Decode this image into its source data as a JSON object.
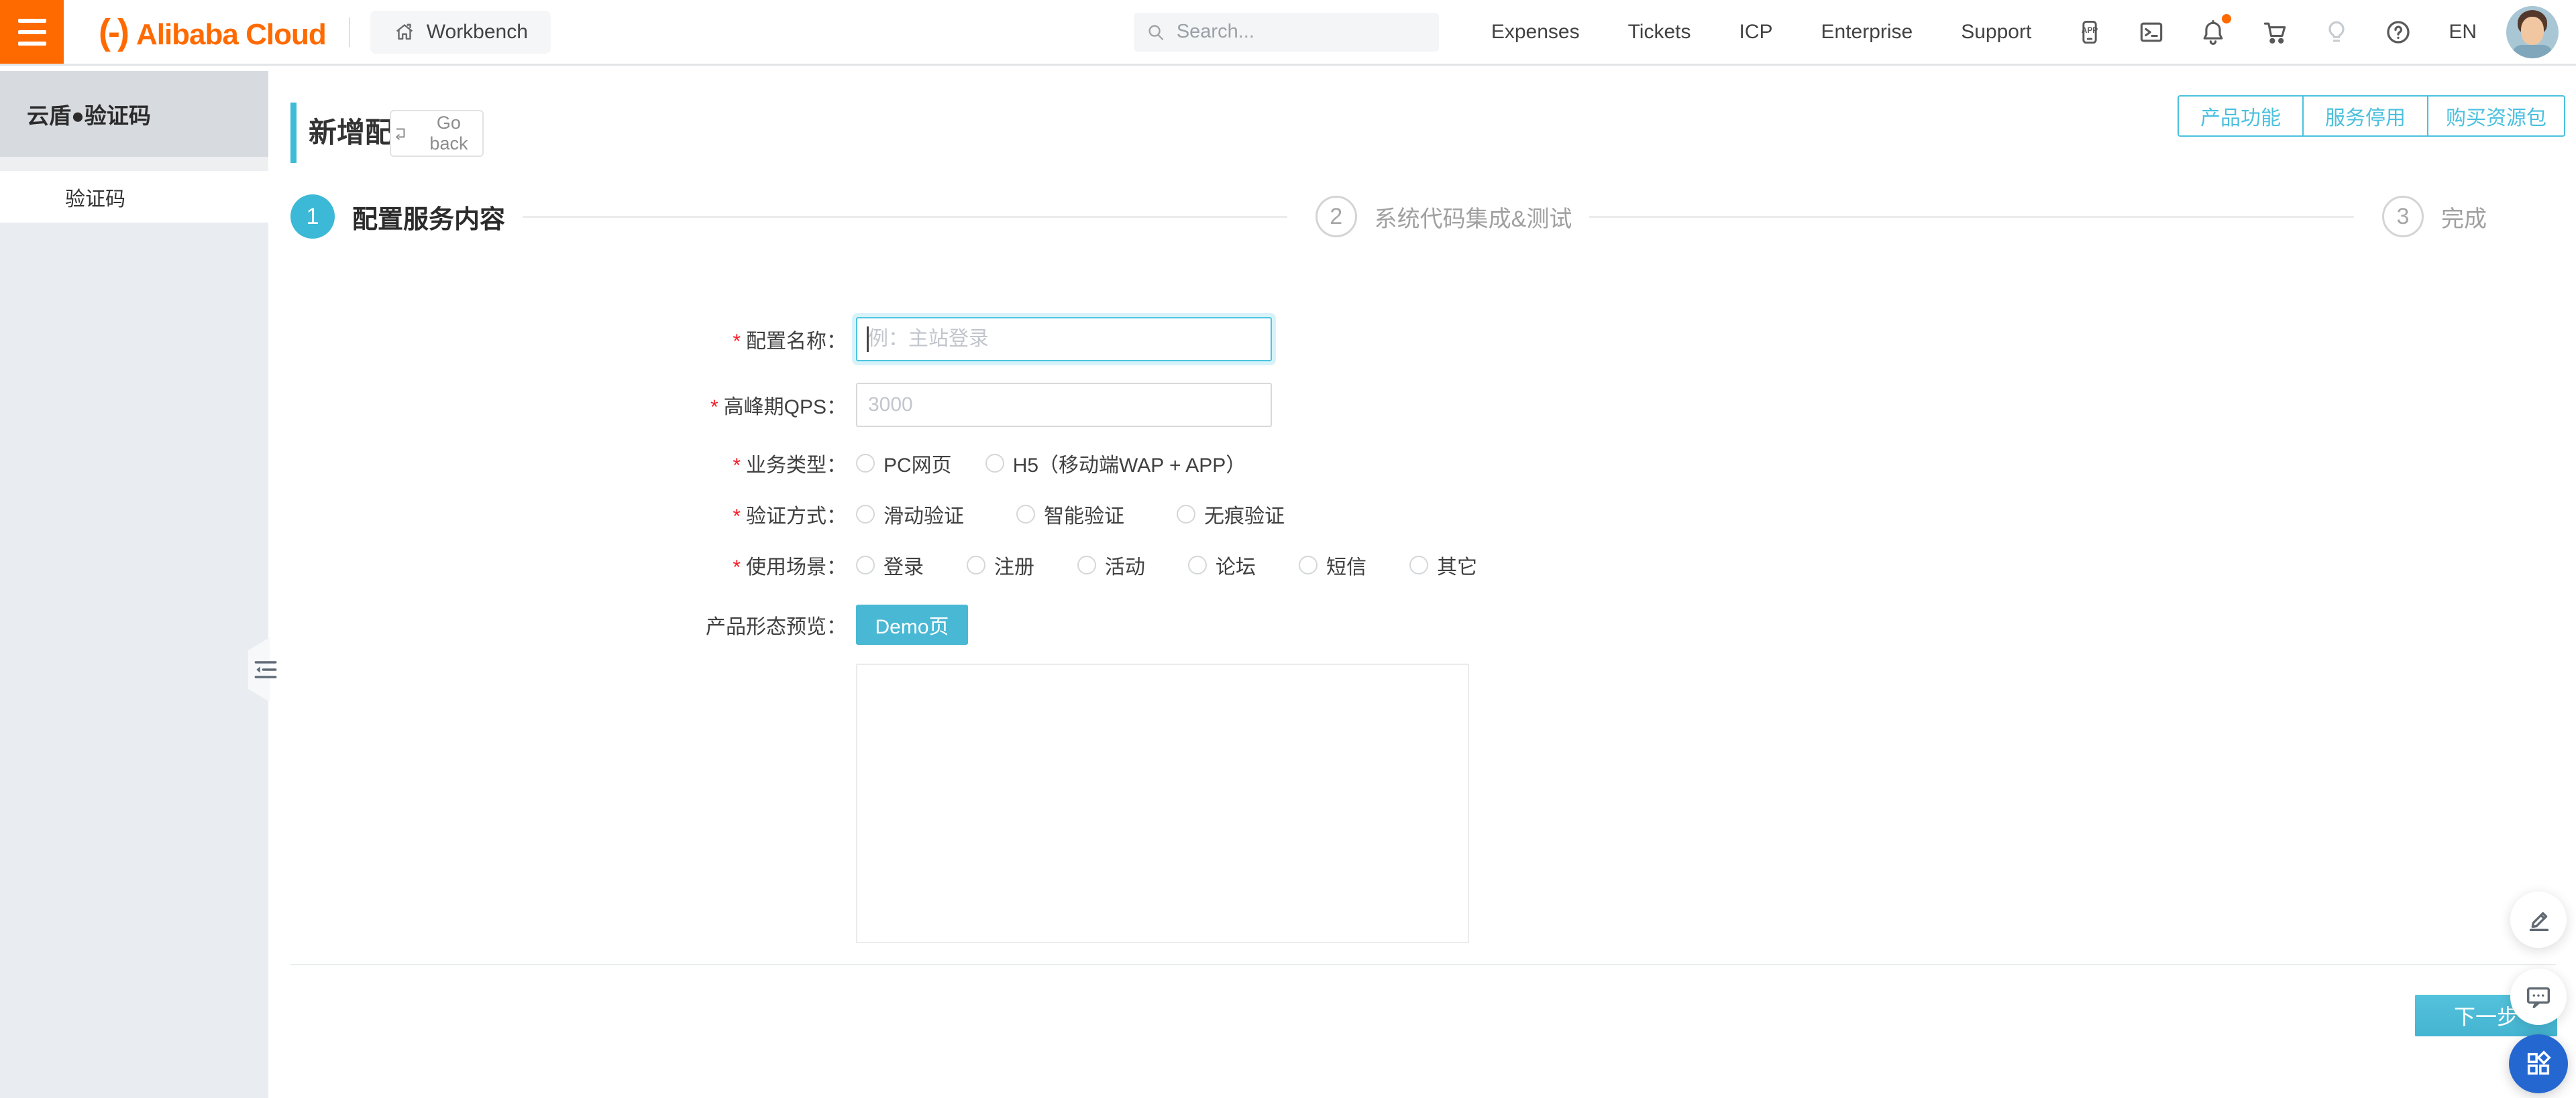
{
  "header": {
    "logo_mark": "(-)",
    "logo_text": "Alibaba Cloud",
    "workbench_label": "Workbench",
    "search_placeholder": "Search...",
    "nav": [
      "Expenses",
      "Tickets",
      "ICP",
      "Enterprise",
      "Support"
    ],
    "lang": "EN"
  },
  "sidebar": {
    "title": "云盾●验证码",
    "items": [
      {
        "label": "验证码"
      }
    ]
  },
  "page": {
    "title": "新增配置",
    "go_back_label": "Go back",
    "actions": [
      "产品功能",
      "服务停用",
      "购买资源包"
    ]
  },
  "steps": [
    {
      "num": "1",
      "label": "配置服务内容"
    },
    {
      "num": "2",
      "label": "系统代码集成&测试"
    },
    {
      "num": "3",
      "label": "完成"
    }
  ],
  "form": {
    "required_mark": "*",
    "rows": [
      {
        "label": "配置名称：",
        "placeholder": "例：主站登录"
      },
      {
        "label": "高峰期QPS：",
        "placeholder": "3000"
      },
      {
        "label": "业务类型：",
        "options": [
          {
            "label": "PC网页"
          },
          {
            "label": "H5（移动端WAP + APP）"
          }
        ]
      },
      {
        "label": "验证方式：",
        "options": [
          {
            "label": "滑动验证"
          },
          {
            "label": "智能验证"
          },
          {
            "label": "无痕验证"
          }
        ]
      },
      {
        "label": "使用场景：",
        "options": [
          {
            "label": "登录"
          },
          {
            "label": "注册"
          },
          {
            "label": "活动"
          },
          {
            "label": "论坛"
          },
          {
            "label": "短信"
          },
          {
            "label": "其它"
          }
        ]
      },
      {
        "label": "产品形态预览：",
        "button_label": "Demo页"
      }
    ]
  },
  "footer": {
    "next_label": "下一步"
  },
  "colors": {
    "accent": "#4BC0DE",
    "orange": "#FF6A00",
    "fab_blue": "#2567D1",
    "step_active": "#3CB9D6"
  }
}
